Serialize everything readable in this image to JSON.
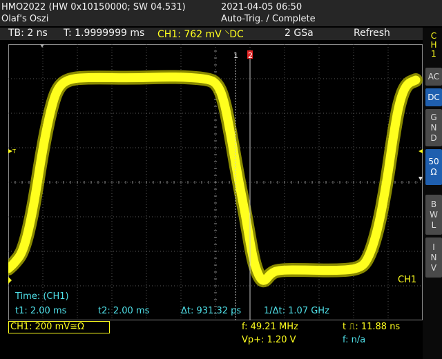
{
  "header": {
    "model": "HMO2022 (HW 0x10150000; SW 04.531)",
    "owner": "Olaf's Oszi",
    "datetime": "2021-04-05 06:50",
    "trigger_status": "Auto-Trig. / Complete"
  },
  "status": {
    "timebase": "TB: 2 ns",
    "trigger_time": "T: 1.9999999 ms",
    "channel_setting": "CH1: 762 mV ⸌DC",
    "sample_rate": "2 GSa",
    "mode": "Refresh"
  },
  "side_panel": {
    "channel": [
      "C",
      "H",
      "1"
    ],
    "buttons": [
      {
        "name": "ac",
        "lines": [
          "AC"
        ],
        "active": false
      },
      {
        "name": "dc",
        "lines": [
          "DC"
        ],
        "active": true
      },
      {
        "name": "gnd",
        "lines": [
          "G",
          "N",
          "D"
        ],
        "active": false
      },
      {
        "name": "50ohm",
        "lines": [
          "50",
          "Ω"
        ],
        "active": true
      },
      {
        "name": "bwl",
        "lines": [
          "B",
          "W",
          "L"
        ],
        "active": false
      },
      {
        "name": "inv",
        "lines": [
          "I",
          "N",
          "V"
        ],
        "active": false
      }
    ]
  },
  "plot": {
    "trace_color": "#ffff1e",
    "grid_color": "#5a5a5a",
    "cursor_1_label": "1",
    "cursor_2_label": "2",
    "trigger_marker": "T",
    "channel_marker": "1",
    "channel_label": "CH1",
    "readout_title": "Time: (CH1)",
    "t1": "t1: 2.00 ms",
    "t2": "t2: 2.00 ms",
    "delta_t": "Δt: 931.32 ps",
    "inv_delta_t": "1/Δt: 1.07 GHz"
  },
  "footer": {
    "ch1_scale": "CH1: 200 mV≅Ω",
    "frequency": "f: 49.21 MHz",
    "vpp": "Vp+: 1.20 V",
    "pulse_width": "t ⎍: 11.88 ns",
    "f2": "f: n/a"
  }
}
